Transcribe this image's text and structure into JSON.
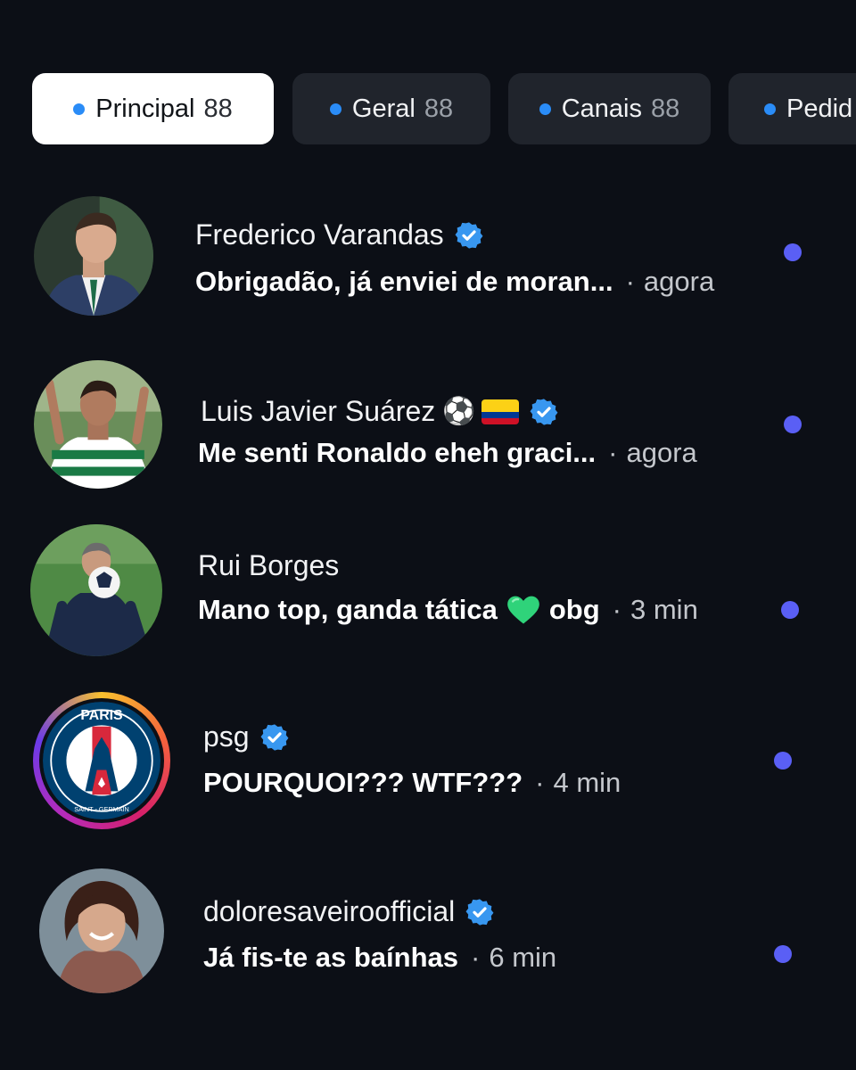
{
  "tabs": [
    {
      "label": "Principal",
      "count": "88",
      "active": true
    },
    {
      "label": "Geral",
      "count": "88",
      "active": false
    },
    {
      "label": "Canais",
      "count": "88",
      "active": false
    },
    {
      "label": "Pedid",
      "count": "",
      "active": false
    }
  ],
  "colors": {
    "background": "#0c0f16",
    "tab_dot": "#2a8cf7",
    "unread_dot": "#5a5ff5",
    "verified": "#3897f0"
  },
  "conversations": [
    {
      "name": "Frederico Varandas",
      "verified": true,
      "message": "Obrigadão, já enviei de moran...",
      "time": "agora",
      "unread": true
    },
    {
      "name": "Luis Javier Suárez",
      "name_emoji": "⚽",
      "flag_icon": "colombia-flag-icon",
      "verified": true,
      "message": "Me senti Ronaldo eheh graci...",
      "time": "agora",
      "unread": true
    },
    {
      "name": "Rui Borges",
      "verified": false,
      "message_pre": "Mano top, ganda tática",
      "message_emoji": "green-heart-icon",
      "message_post": "obg",
      "time": "3 min",
      "unread": true
    },
    {
      "name": "psg",
      "verified": true,
      "message": "POURQUOI??? WTF???",
      "time": "4 min",
      "unread": true,
      "story_ring": true,
      "avatar_text_top": "PARIS",
      "avatar_text_bottom": "SAINT - GERMAIN"
    },
    {
      "name": "doloresaveiroofficial",
      "verified": true,
      "message": "Já fis-te as baínhas",
      "time": "6 min",
      "unread": true
    }
  ],
  "separator": "·"
}
